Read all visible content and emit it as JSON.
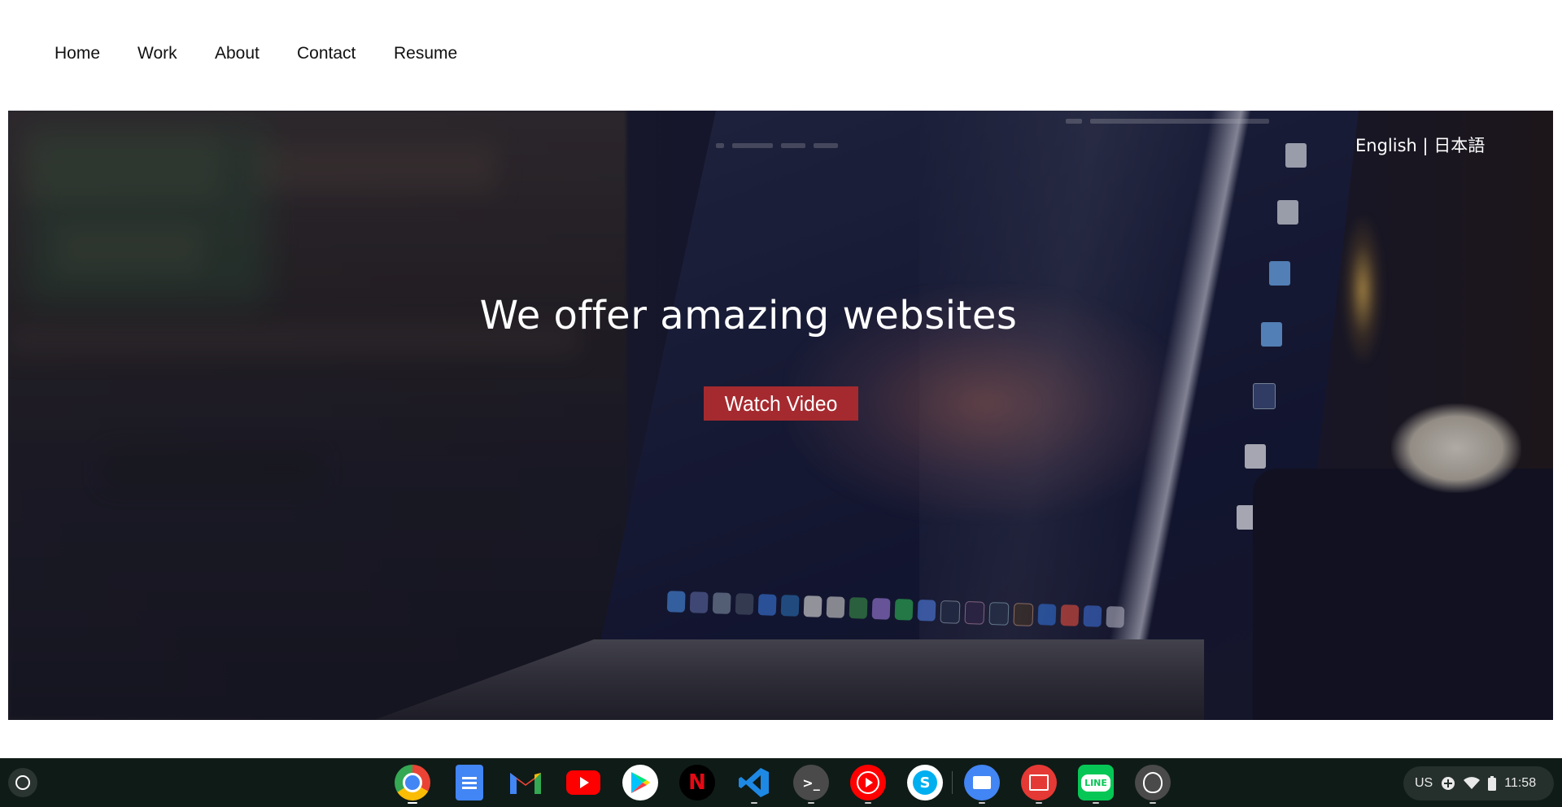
{
  "nav": {
    "items": [
      {
        "label": "Home"
      },
      {
        "label": "Work"
      },
      {
        "label": "About"
      },
      {
        "label": "Contact"
      },
      {
        "label": "Resume"
      }
    ]
  },
  "hero": {
    "language_switch": "English | 日本語",
    "headline": "We offer amazing websites",
    "cta_label": "Watch Video",
    "cta_color": "#a52a2f"
  },
  "shelf": {
    "launcher_icon": "launcher-icon",
    "apps": [
      {
        "name": "chrome-icon",
        "color": "#ffffff",
        "active": true
      },
      {
        "name": "docs-icon",
        "color": "#4285f4"
      },
      {
        "name": "gmail-icon",
        "color": "#ffffff"
      },
      {
        "name": "youtube-icon",
        "color": "#ff0000"
      },
      {
        "name": "play-store-icon",
        "color": "#ffffff"
      },
      {
        "name": "netflix-icon",
        "color": "#000000"
      },
      {
        "name": "vscode-icon",
        "color": "#1e88e5"
      },
      {
        "name": "terminal-icon",
        "color": "#4a4a4a",
        "glyph": ">_"
      },
      {
        "name": "youtube-music-icon",
        "color": "#ff0000"
      },
      {
        "name": "skype-icon",
        "color": "#ffffff"
      },
      {
        "name": "files-icon",
        "color": "#4285f4"
      },
      {
        "name": "gallery-icon",
        "color": "#e53935"
      },
      {
        "name": "line-icon",
        "color": "#06c755"
      },
      {
        "name": "extension-icon",
        "color": "#4a4a4a"
      }
    ],
    "tray": {
      "keyboard_layout": "US",
      "time": "11:58"
    }
  }
}
